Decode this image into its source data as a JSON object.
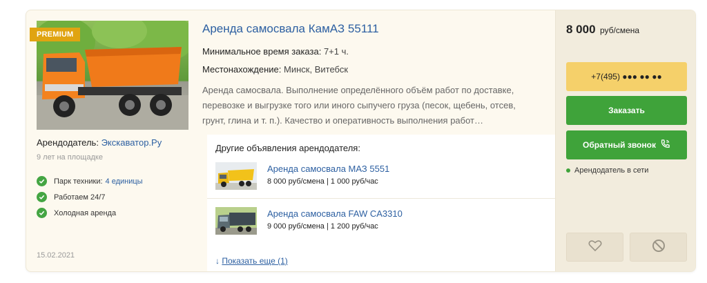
{
  "listing": {
    "badge": "PREMIUM",
    "title": "Аренда самосвала КамАЗ 55111",
    "min_order_label": "Минимальное время заказа:",
    "min_order_value": "7+1 ч.",
    "location_label": "Местонахождение:",
    "location_value": "Минск, Витебск",
    "description": "Аренда самосвала. Выполнение определённого объём работ по доставке, перевозке и выгрузке того или иного сыпучего груза (песок, щебень, отсев, грунт, глина и т. п.). Качество и оперативность выполнения работ…",
    "date": "15.02.2021"
  },
  "owner": {
    "label": "Арендодатель:",
    "name": "Экскаватор.Ру",
    "since": "9 лет на площадке",
    "features": [
      {
        "label": "Парк техники:",
        "link": "4 единицы"
      },
      {
        "label": "Работаем 24/7"
      },
      {
        "label": "Холодная аренда"
      }
    ]
  },
  "other_ads": {
    "title": "Другие объявления арендодателя:",
    "items": [
      {
        "title": "Аренда самосвала МАЗ 5551",
        "price": "8 000 руб/смена | 1 000 руб/час"
      },
      {
        "title": "Аренда самосвала FAW CA3310",
        "price": "9 000 руб/смена | 1 200 руб/час"
      }
    ],
    "show_more": "Показать еще (1)"
  },
  "sidebar": {
    "price_value": "8 000",
    "price_unit": "руб/смена",
    "phone": "+7(495) ●●● ●● ●●",
    "order_button": "Заказать",
    "callback_button": "Обратный звонок",
    "online_status": "Арендодатель в сети"
  },
  "icons": {
    "check": "check-circle-icon",
    "phone": "phone-ring-icon",
    "favorite": "heart-icon",
    "block": "block-icon"
  },
  "colors": {
    "link": "#2c5fa1",
    "green": "#3fa33a",
    "yellow": "#f5d06a",
    "premium": "#e0a411"
  }
}
